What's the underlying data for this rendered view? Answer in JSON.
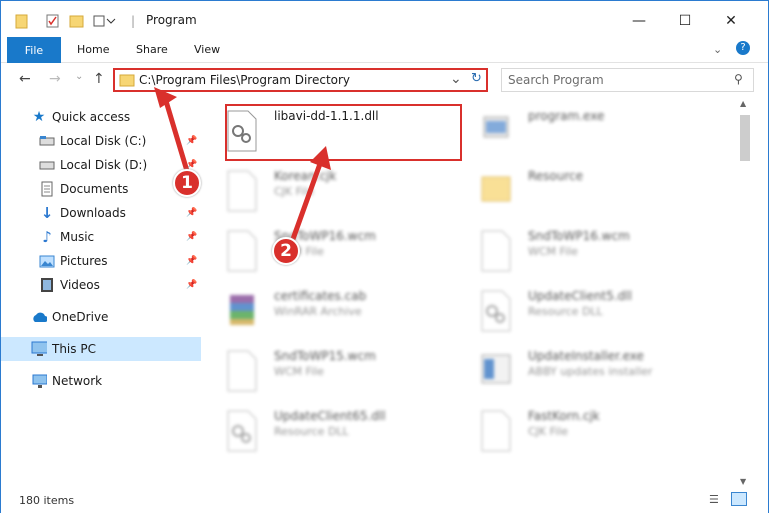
{
  "window": {
    "title": "Program"
  },
  "ribbon": {
    "tabs": [
      "File",
      "Home",
      "Share",
      "View"
    ]
  },
  "address": {
    "path": "C:\\Program Files\\Program Directory"
  },
  "search": {
    "placeholder": "Search Program"
  },
  "navpane": {
    "quick_access": "Quick access",
    "items": [
      {
        "label": "Local Disk (C:)",
        "icon": "drive-icon",
        "pinned": true
      },
      {
        "label": "Local Disk (D:)",
        "icon": "drive-icon",
        "pinned": true
      },
      {
        "label": "Documents",
        "icon": "documents-icon",
        "pinned": true
      },
      {
        "label": "Downloads",
        "icon": "downloads-icon",
        "pinned": true
      },
      {
        "label": "Music",
        "icon": "music-icon",
        "pinned": true
      },
      {
        "label": "Pictures",
        "icon": "pictures-icon",
        "pinned": true
      },
      {
        "label": "Videos",
        "icon": "videos-icon",
        "pinned": true
      }
    ],
    "onedrive": "OneDrive",
    "thispc": "This PC",
    "network": "Network"
  },
  "files": [
    {
      "name": "libavi-dd-1.1.1.dll",
      "type": "",
      "icon": "dll-gear-icon",
      "highlighted": true
    },
    {
      "name": "program.exe",
      "type": "",
      "icon": "exe-icon"
    },
    {
      "name": "Korean.cjk",
      "type": "CJK File",
      "icon": "blank-file-icon"
    },
    {
      "name": "Resource",
      "type": "",
      "icon": "folder-icon"
    },
    {
      "name": "SndToWP16.wcm",
      "type": "WCM File",
      "icon": "blank-file-icon"
    },
    {
      "name": "SndToWP16.wcm",
      "type": "WCM File",
      "icon": "blank-file-icon"
    },
    {
      "name": "certificates.cab",
      "type": "WinRAR Archive",
      "icon": "winrar-icon"
    },
    {
      "name": "UpdateClient5.dll",
      "type": "Resource DLL",
      "icon": "dll-gear-icon"
    },
    {
      "name": "SndToWP15.wcm",
      "type": "WCM File",
      "icon": "blank-file-icon"
    },
    {
      "name": "UpdateInstaller.exe",
      "type": "ABBY updates installer",
      "icon": "installer-icon"
    },
    {
      "name": "UpdateClient65.dll",
      "type": "Resource DLL",
      "icon": "dll-gear-icon"
    },
    {
      "name": "FastKorn.cjk",
      "type": "CJK File",
      "icon": "blank-file-icon"
    }
  ],
  "annotations": {
    "badge1": "1",
    "badge2": "2"
  },
  "status": {
    "count": "180 items"
  },
  "colors": {
    "accent": "#1979ca",
    "highlight": "#d9302c",
    "selected": "#cce8ff"
  }
}
